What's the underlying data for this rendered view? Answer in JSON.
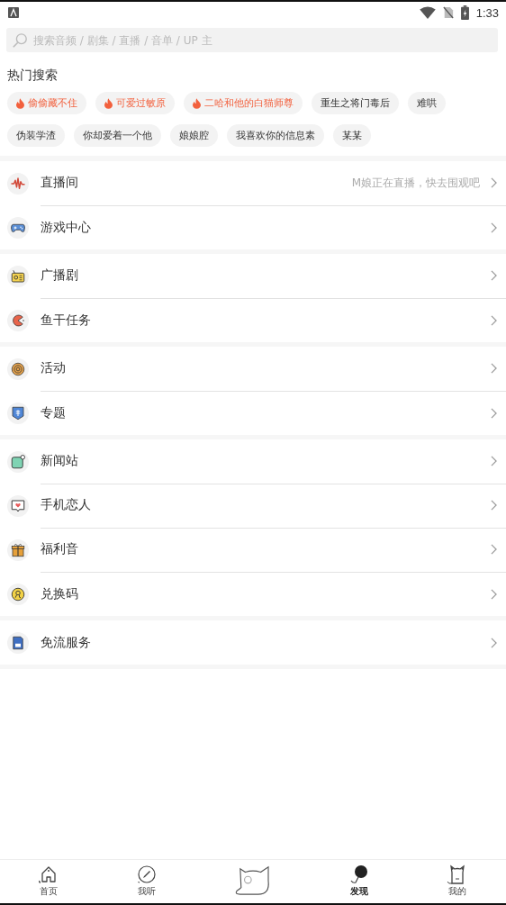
{
  "status_bar": {
    "time": "1:33"
  },
  "search": {
    "placeholder": "搜索音频 / 剧集 / 直播 / 音单 / UP 主"
  },
  "hot_search": {
    "title": "热门搜索",
    "chips": [
      {
        "label": "偷偷藏不住",
        "hot": true
      },
      {
        "label": "可爱过敏原",
        "hot": true
      },
      {
        "label": "二哈和他的白猫师尊",
        "hot": true
      },
      {
        "label": "重生之将门毒后",
        "hot": false
      },
      {
        "label": "难哄",
        "hot": false
      },
      {
        "label": "伪装学渣",
        "hot": false
      },
      {
        "label": "你却爱着一个他",
        "hot": false
      },
      {
        "label": "娘娘腔",
        "hot": false
      },
      {
        "label": "我喜欢你的信息素",
        "hot": false
      },
      {
        "label": "某某",
        "hot": false
      }
    ]
  },
  "menu_groups": [
    {
      "items": [
        {
          "label": "直播间",
          "hint": "M娘正在直播，快去围观吧"
        },
        {
          "label": "游戏中心"
        }
      ]
    },
    {
      "items": [
        {
          "label": "广播剧"
        },
        {
          "label": "鱼干任务"
        }
      ]
    },
    {
      "items": [
        {
          "label": "活动"
        },
        {
          "label": "专题"
        }
      ]
    },
    {
      "items": [
        {
          "label": "新闻站"
        },
        {
          "label": "手机恋人"
        },
        {
          "label": "福利音"
        },
        {
          "label": "兑换码"
        }
      ]
    },
    {
      "items": [
        {
          "label": "免流服务"
        }
      ]
    }
  ],
  "bottom_nav": [
    {
      "label": "首页",
      "selected": false
    },
    {
      "label": "我听",
      "selected": false
    },
    {
      "kind": "center"
    },
    {
      "label": "发现",
      "selected": true
    },
    {
      "label": "我的",
      "selected": false
    }
  ]
}
